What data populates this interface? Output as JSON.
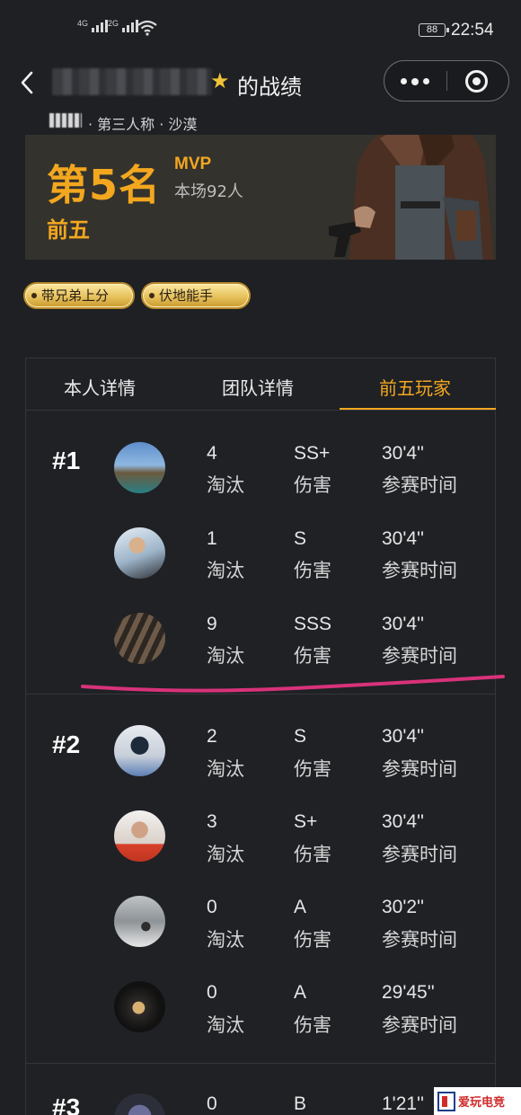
{
  "status_bar": {
    "sig1_label": "4G",
    "sig2_label": "2G",
    "battery": "88",
    "time": "22:54"
  },
  "header": {
    "title": "的战绩"
  },
  "match": {
    "mode": "· 第三人称 · 沙漠",
    "rank": "第5名",
    "mvp": "MVP",
    "players": "本场92人",
    "tier": "前五"
  },
  "badges": [
    "带兄弟上分",
    "伏地能手"
  ],
  "tabs": [
    "本人详情",
    "团队详情",
    "前五玩家"
  ],
  "labels": {
    "kills": "淘汰",
    "damage": "伤害",
    "time": "参赛时间"
  },
  "groups": [
    {
      "label": "#1",
      "players": [
        {
          "kills": "4",
          "damage": "SS+",
          "time": "30'4''"
        },
        {
          "kills": "1",
          "damage": "S",
          "time": "30'4''"
        },
        {
          "kills": "9",
          "damage": "SSS",
          "time": "30'4''"
        }
      ]
    },
    {
      "label": "#2",
      "players": [
        {
          "kills": "2",
          "damage": "S",
          "time": "30'4''"
        },
        {
          "kills": "3",
          "damage": "S+",
          "time": "30'4''"
        },
        {
          "kills": "0",
          "damage": "A",
          "time": "30'2''"
        },
        {
          "kills": "0",
          "damage": "A",
          "time": "29'45''"
        }
      ]
    },
    {
      "label": "#3",
      "players": [
        {
          "kills": "0",
          "damage": "B",
          "time": "1'21''"
        }
      ]
    }
  ],
  "watermark": "爱玩电竞"
}
